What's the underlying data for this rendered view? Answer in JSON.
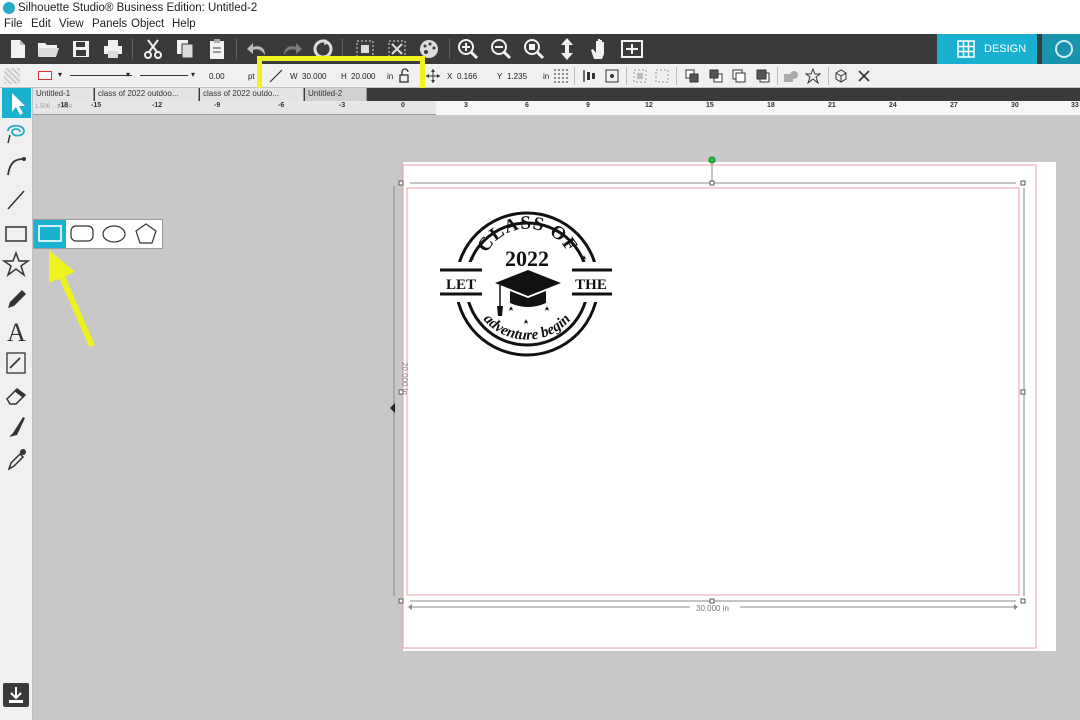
{
  "titlebar": {
    "title": "Silhouette Studio® Business Edition: Untitled-2"
  },
  "menu": [
    "File",
    "Edit",
    "View",
    "Panels",
    "Object",
    "Help"
  ],
  "maintool": {
    "icons": [
      "new-file",
      "open-folder",
      "save",
      "print",
      "cut",
      "copy",
      "paste",
      "undo",
      "redo",
      "redraw",
      "group",
      "ungroup",
      "palette",
      "zoom-in",
      "zoom-out",
      "zoom-selection",
      "move-pan",
      "hand",
      "fit-page"
    ],
    "design_tab": "DESIGN"
  },
  "properties": {
    "line_width": "0.00",
    "line_unit": "pt",
    "w_label": "W",
    "w_value": "30.000",
    "h_label": "H",
    "h_value": "20.000",
    "size_unit": "in",
    "x_label": "X",
    "x_value": "0.166",
    "y_label": "Y",
    "y_value": "1.235",
    "pos_unit": "in"
  },
  "doc_tabs": [
    "Untitled-1",
    "class of 2022 outdoo...",
    "class of 2022 outdo...",
    "Untitled-2"
  ],
  "ruler": {
    "coords": "1.506 , -1.834",
    "ticks": [
      "-18",
      "-15",
      "-12",
      "-9",
      "-6",
      "-3",
      "0",
      "3",
      "6",
      "9",
      "12",
      "15",
      "18",
      "21",
      "24",
      "27",
      "30",
      "33"
    ]
  },
  "left_tools": [
    "select",
    "point-edit",
    "curve",
    "line",
    "rectangle",
    "star",
    "pencil",
    "text",
    "sketch",
    "eraser",
    "knife",
    "eyedropper"
  ],
  "flyout_shapes": [
    "rectangle",
    "rounded-rectangle",
    "ellipse",
    "polygon"
  ],
  "selection": {
    "height_label": "20.000 in",
    "width_label": "30.000 in"
  },
  "design": {
    "top_text": "CLASS OF",
    "year": "2022",
    "left_word": "LET",
    "right_word": "THE",
    "script_text": "adventure begin"
  },
  "colors": {
    "accent": "#1ab0d0",
    "highlight": "#eef21f",
    "toolbar": "#3a3a3a",
    "cut_line": "#e8a0a8"
  }
}
